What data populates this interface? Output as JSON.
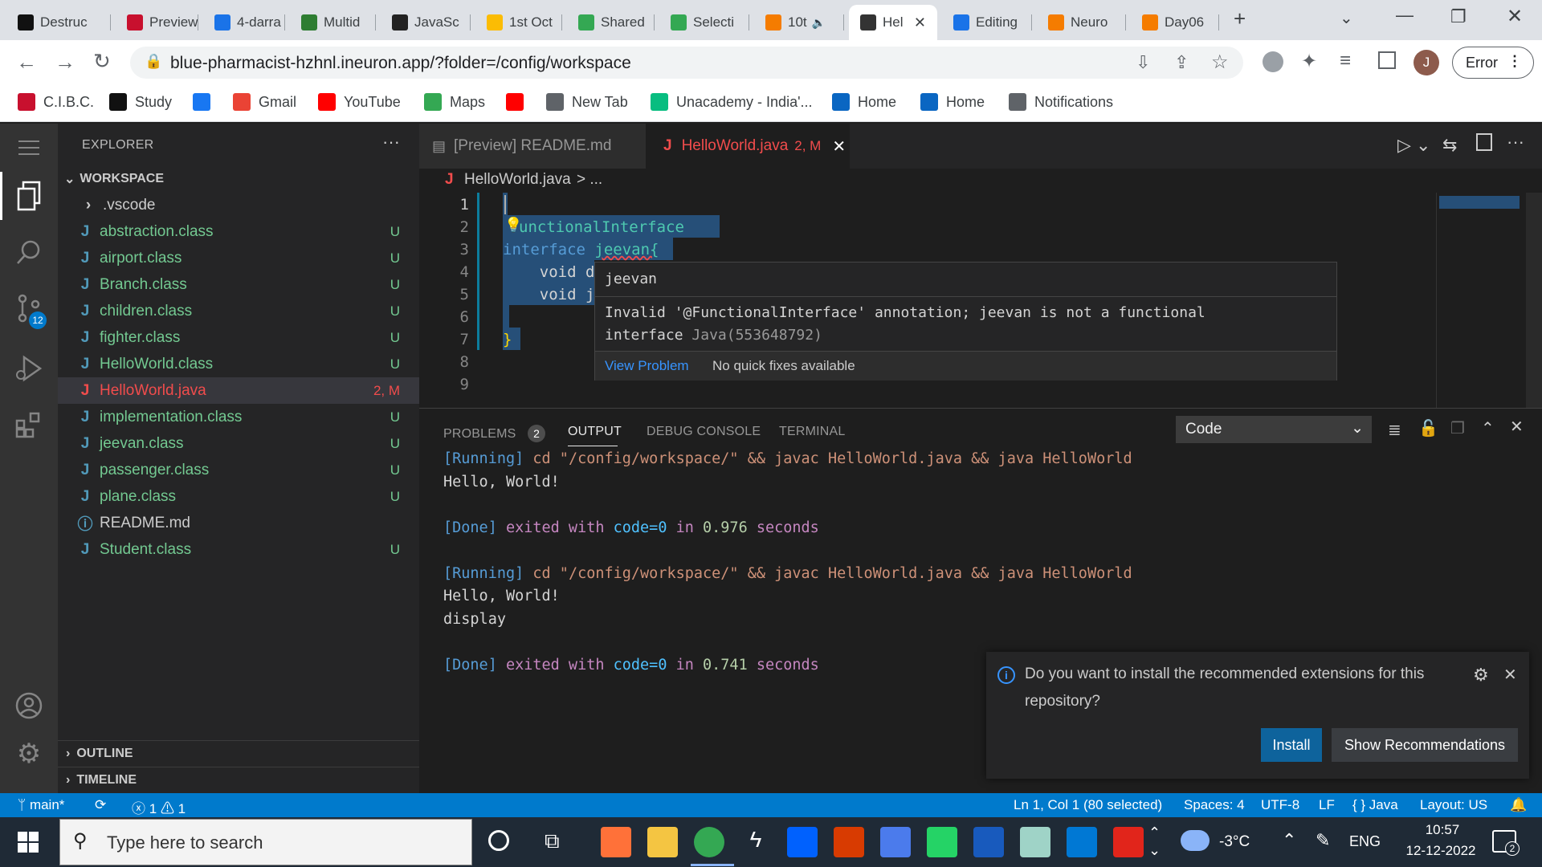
{
  "browser": {
    "tabs": [
      {
        "label": "Destruc",
        "color": "#111111"
      },
      {
        "label": "Preview",
        "color": "#c8102e"
      },
      {
        "label": "4-darra",
        "color": "#1a73e8"
      },
      {
        "label": "Multid",
        "color": "#2e7d32"
      },
      {
        "label": "JavaSc",
        "color": "#222222"
      },
      {
        "label": "1st Oct",
        "color": "#fbbc04"
      },
      {
        "label": "Shared",
        "color": "#34a853"
      },
      {
        "label": "Selecti",
        "color": "#34a853"
      },
      {
        "label": "10t",
        "color": "#f57c00"
      },
      {
        "label": "Hel",
        "color": "#333333"
      },
      {
        "label": "Editing",
        "color": "#1a73e8"
      },
      {
        "label": "Neuro",
        "color": "#f57c00"
      },
      {
        "label": "Day06",
        "color": "#f57c00"
      }
    ],
    "new_tab": "+",
    "url": "blue-pharmacist-hzhnl.ineuron.app/?folder=/config/workspace",
    "profile_initial": "J",
    "error_button": "Error",
    "bookmarks": [
      {
        "label": "C.I.B.C.",
        "color": "#c8102e"
      },
      {
        "label": "Study",
        "color": "#111111"
      },
      {
        "label": "",
        "color": "#1877f2"
      },
      {
        "label": "Gmail",
        "color": "#ea4335"
      },
      {
        "label": "YouTube",
        "color": "#ff0000"
      },
      {
        "label": "Maps",
        "color": "#34a853"
      },
      {
        "label": "",
        "color": "#ff0000"
      },
      {
        "label": "New Tab",
        "color": "#5f6368"
      },
      {
        "label": "Unacademy - India'...",
        "color": "#08bd80"
      },
      {
        "label": "Home",
        "color": "#0a66c2"
      },
      {
        "label": "Home",
        "color": "#0a66c2"
      },
      {
        "label": "Notifications",
        "color": "#5f6368"
      }
    ]
  },
  "vscode": {
    "activity_badge": "12",
    "explorer_title": "EXPLORER",
    "workspace_title": "WORKSPACE",
    "files": [
      {
        "name": ".vscode",
        "kind": "folder",
        "badge": ""
      },
      {
        "name": "abstraction.class",
        "kind": "class",
        "badge": "U"
      },
      {
        "name": "airport.class",
        "kind": "class",
        "badge": "U"
      },
      {
        "name": "Branch.class",
        "kind": "class",
        "badge": "U"
      },
      {
        "name": "children.class",
        "kind": "class",
        "badge": "U"
      },
      {
        "name": "fighter.class",
        "kind": "class",
        "badge": "U"
      },
      {
        "name": "HelloWorld.class",
        "kind": "class",
        "badge": "U"
      },
      {
        "name": "HelloWorld.java",
        "kind": "java",
        "badge": "2, M"
      },
      {
        "name": "implementation.class",
        "kind": "class",
        "badge": "U"
      },
      {
        "name": "jeevan.class",
        "kind": "class",
        "badge": "U"
      },
      {
        "name": "passenger.class",
        "kind": "class",
        "badge": "U"
      },
      {
        "name": "plane.class",
        "kind": "class",
        "badge": "U"
      },
      {
        "name": "README.md",
        "kind": "info",
        "badge": ""
      },
      {
        "name": "Student.class",
        "kind": "class",
        "badge": "U"
      }
    ],
    "outline": "OUTLINE",
    "timeline": "TIMELINE",
    "editor_tabs": [
      {
        "label": "[Preview] README.md"
      },
      {
        "label": "HelloWorld.java",
        "suffix": "2, M"
      }
    ],
    "breadcrumb": {
      "file": "HelloWorld.java",
      "rest": "> ..."
    },
    "code_lines": [
      {
        "n": "1",
        "text": ""
      },
      {
        "n": "2",
        "text": "unctionalInterface"
      },
      {
        "n": "3",
        "kw": "interface",
        "name": "jeevan{"
      },
      {
        "n": "4",
        "text": "    void d"
      },
      {
        "n": "5",
        "text": "    void j"
      },
      {
        "n": "6",
        "text": ""
      },
      {
        "n": "7",
        "text": "}"
      },
      {
        "n": "8",
        "text": ""
      },
      {
        "n": "9",
        "text": ""
      }
    ],
    "hover": {
      "title": "jeevan",
      "message_line1": "Invalid '@FunctionalInterface' annotation; jeevan is not a functional",
      "message_line2": "interface",
      "source": "Java(553648792)",
      "view_problem": "View Problem",
      "no_fixes": "No quick fixes available"
    },
    "panel": {
      "tabs": [
        "PROBLEMS",
        "OUTPUT",
        "DEBUG CONSOLE",
        "TERMINAL"
      ],
      "problems_count": "2",
      "channel": "Code",
      "output": [
        {
          "type": "running",
          "tag": "[Running]",
          "cmd": " cd \"/config/workspace/\" && javac HelloWorld.java && java HelloWorld"
        },
        {
          "type": "plain",
          "text": "Hello, World!"
        },
        {
          "type": "blank"
        },
        {
          "type": "done",
          "tag": "[Done]",
          "pre": " exited with ",
          "code": "code=0",
          "mid": " in ",
          "time": "0.976",
          "post": " seconds"
        },
        {
          "type": "blank"
        },
        {
          "type": "running",
          "tag": "[Running]",
          "cmd": " cd \"/config/workspace/\" && javac HelloWorld.java && java HelloWorld"
        },
        {
          "type": "plain",
          "text": "Hello, World!"
        },
        {
          "type": "plain",
          "text": "display"
        },
        {
          "type": "blank"
        },
        {
          "type": "done",
          "tag": "[Done]",
          "pre": " exited with ",
          "code": "code=0",
          "mid": " in ",
          "time": "0.741",
          "post": " seconds"
        }
      ]
    },
    "notification": {
      "line1": "Do you want to install the recommended extensions for this",
      "line2": "repository?",
      "install": "Install",
      "show": "Show Recommendations"
    },
    "status": {
      "branch": "main*",
      "errors": "1",
      "warnings": "1",
      "position": "Ln 1, Col 1 (80 selected)",
      "spaces": "Spaces: 4",
      "encoding": "UTF-8",
      "eol": "LF",
      "language": "{ } Java",
      "layout": "Layout: US"
    }
  },
  "taskbar": {
    "search_placeholder": "Type here to search",
    "weather": "-3°C",
    "lang": "ENG",
    "time": "10:57",
    "date": "12-12-2022",
    "notif_count": "2",
    "app_colors": [
      "#ff7139",
      "#f4c542",
      "#34a853",
      "#ffffff",
      "#0061fe",
      "#d83b01",
      "#4b7bec",
      "#25d366",
      "#185abd",
      "#9fd3c7",
      "#0078d4",
      "#e1251b"
    ]
  }
}
